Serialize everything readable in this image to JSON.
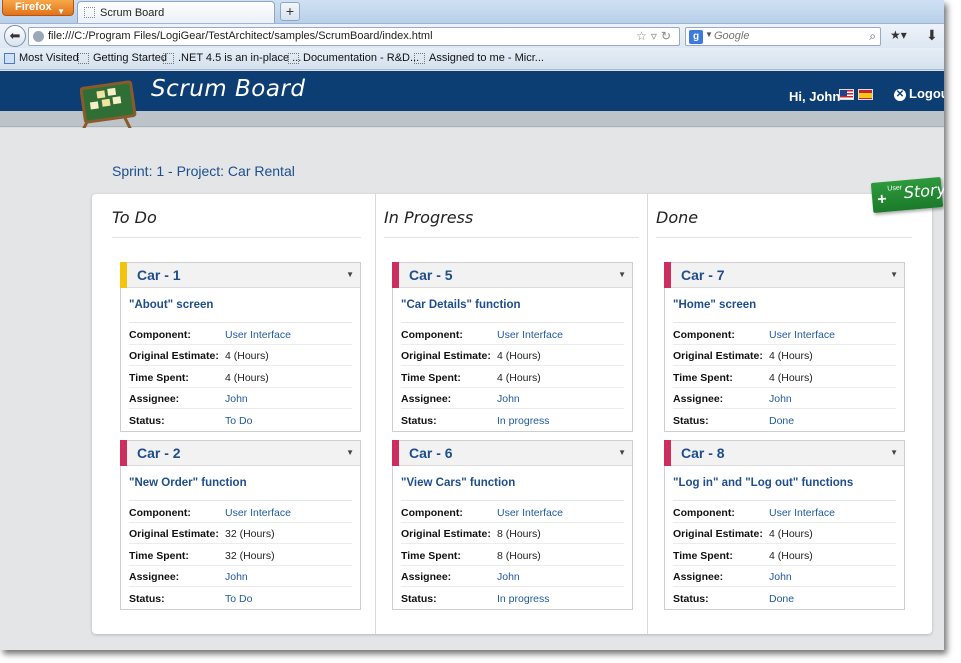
{
  "browser": {
    "app_button": "Firefox",
    "tab_title": "Scrum Board",
    "new_tab": "+",
    "url": "file:///C:/Program Files/LogiGear/TestArchitect/samples/ScrumBoard/index.html",
    "search_placeholder": "Google",
    "search_engine_letter": "g"
  },
  "bookmarks": [
    {
      "label": "Most Visited"
    },
    {
      "label": "Getting Started"
    },
    {
      "label": ".NET 4.5 is an in-place ..."
    },
    {
      "label": "Documentation - R&D..."
    },
    {
      "label": "Assigned to me - Micr..."
    }
  ],
  "app": {
    "title": "Scrum Board",
    "greeting": "Hi, John",
    "logout": "Logout",
    "sprint_heading": "Sprint: 1 - Project: Car Rental",
    "add_button_small": "User",
    "add_button_big": "Story"
  },
  "columns": [
    {
      "title": "To Do",
      "cards": [
        {
          "id": "Car - 1",
          "accent": "#f2c40f",
          "title": "\"About\" screen",
          "component": "User Interface",
          "original_estimate": "4 (Hours)",
          "time_spent": "4 (Hours)",
          "assignee": "John",
          "status": "To Do"
        },
        {
          "id": "Car - 2",
          "accent": "#cc2e5d",
          "title": "\"New Order\" function",
          "component": "User Interface",
          "original_estimate": "32 (Hours)",
          "time_spent": "32 (Hours)",
          "assignee": "John",
          "status": "To Do"
        }
      ]
    },
    {
      "title": "In Progress",
      "cards": [
        {
          "id": "Car - 5",
          "accent": "#cc2e5d",
          "title": "\"Car Details\" function",
          "component": "User Interface",
          "original_estimate": "4 (Hours)",
          "time_spent": "4 (Hours)",
          "assignee": "John",
          "status": "In progress"
        },
        {
          "id": "Car - 6",
          "accent": "#cc2e5d",
          "title": "\"View Cars\" function",
          "component": "User Interface",
          "original_estimate": "8 (Hours)",
          "time_spent": "8 (Hours)",
          "assignee": "John",
          "status": "In progress"
        }
      ]
    },
    {
      "title": "Done",
      "cards": [
        {
          "id": "Car - 7",
          "accent": "#cc2e5d",
          "title": "\"Home\" screen",
          "component": "User Interface",
          "original_estimate": "4 (Hours)",
          "time_spent": "4 (Hours)",
          "assignee": "John",
          "status": "Done"
        },
        {
          "id": "Car - 8",
          "accent": "#cc2e5d",
          "title": "\"Log in\" and \"Log out\" functions",
          "component": "User Interface",
          "original_estimate": "4 (Hours)",
          "time_spent": "4 (Hours)",
          "assignee": "John",
          "status": "Done"
        }
      ]
    }
  ],
  "field_labels": {
    "component": "Component:",
    "original_estimate": "Original Estimate:",
    "time_spent": "Time Spent:",
    "assignee": "Assignee:",
    "status": "Status:"
  },
  "colors": {
    "header_bg": "#0d3e73",
    "link_blue": "#1e4e8c",
    "add_story_green": "#2e9a3c"
  }
}
